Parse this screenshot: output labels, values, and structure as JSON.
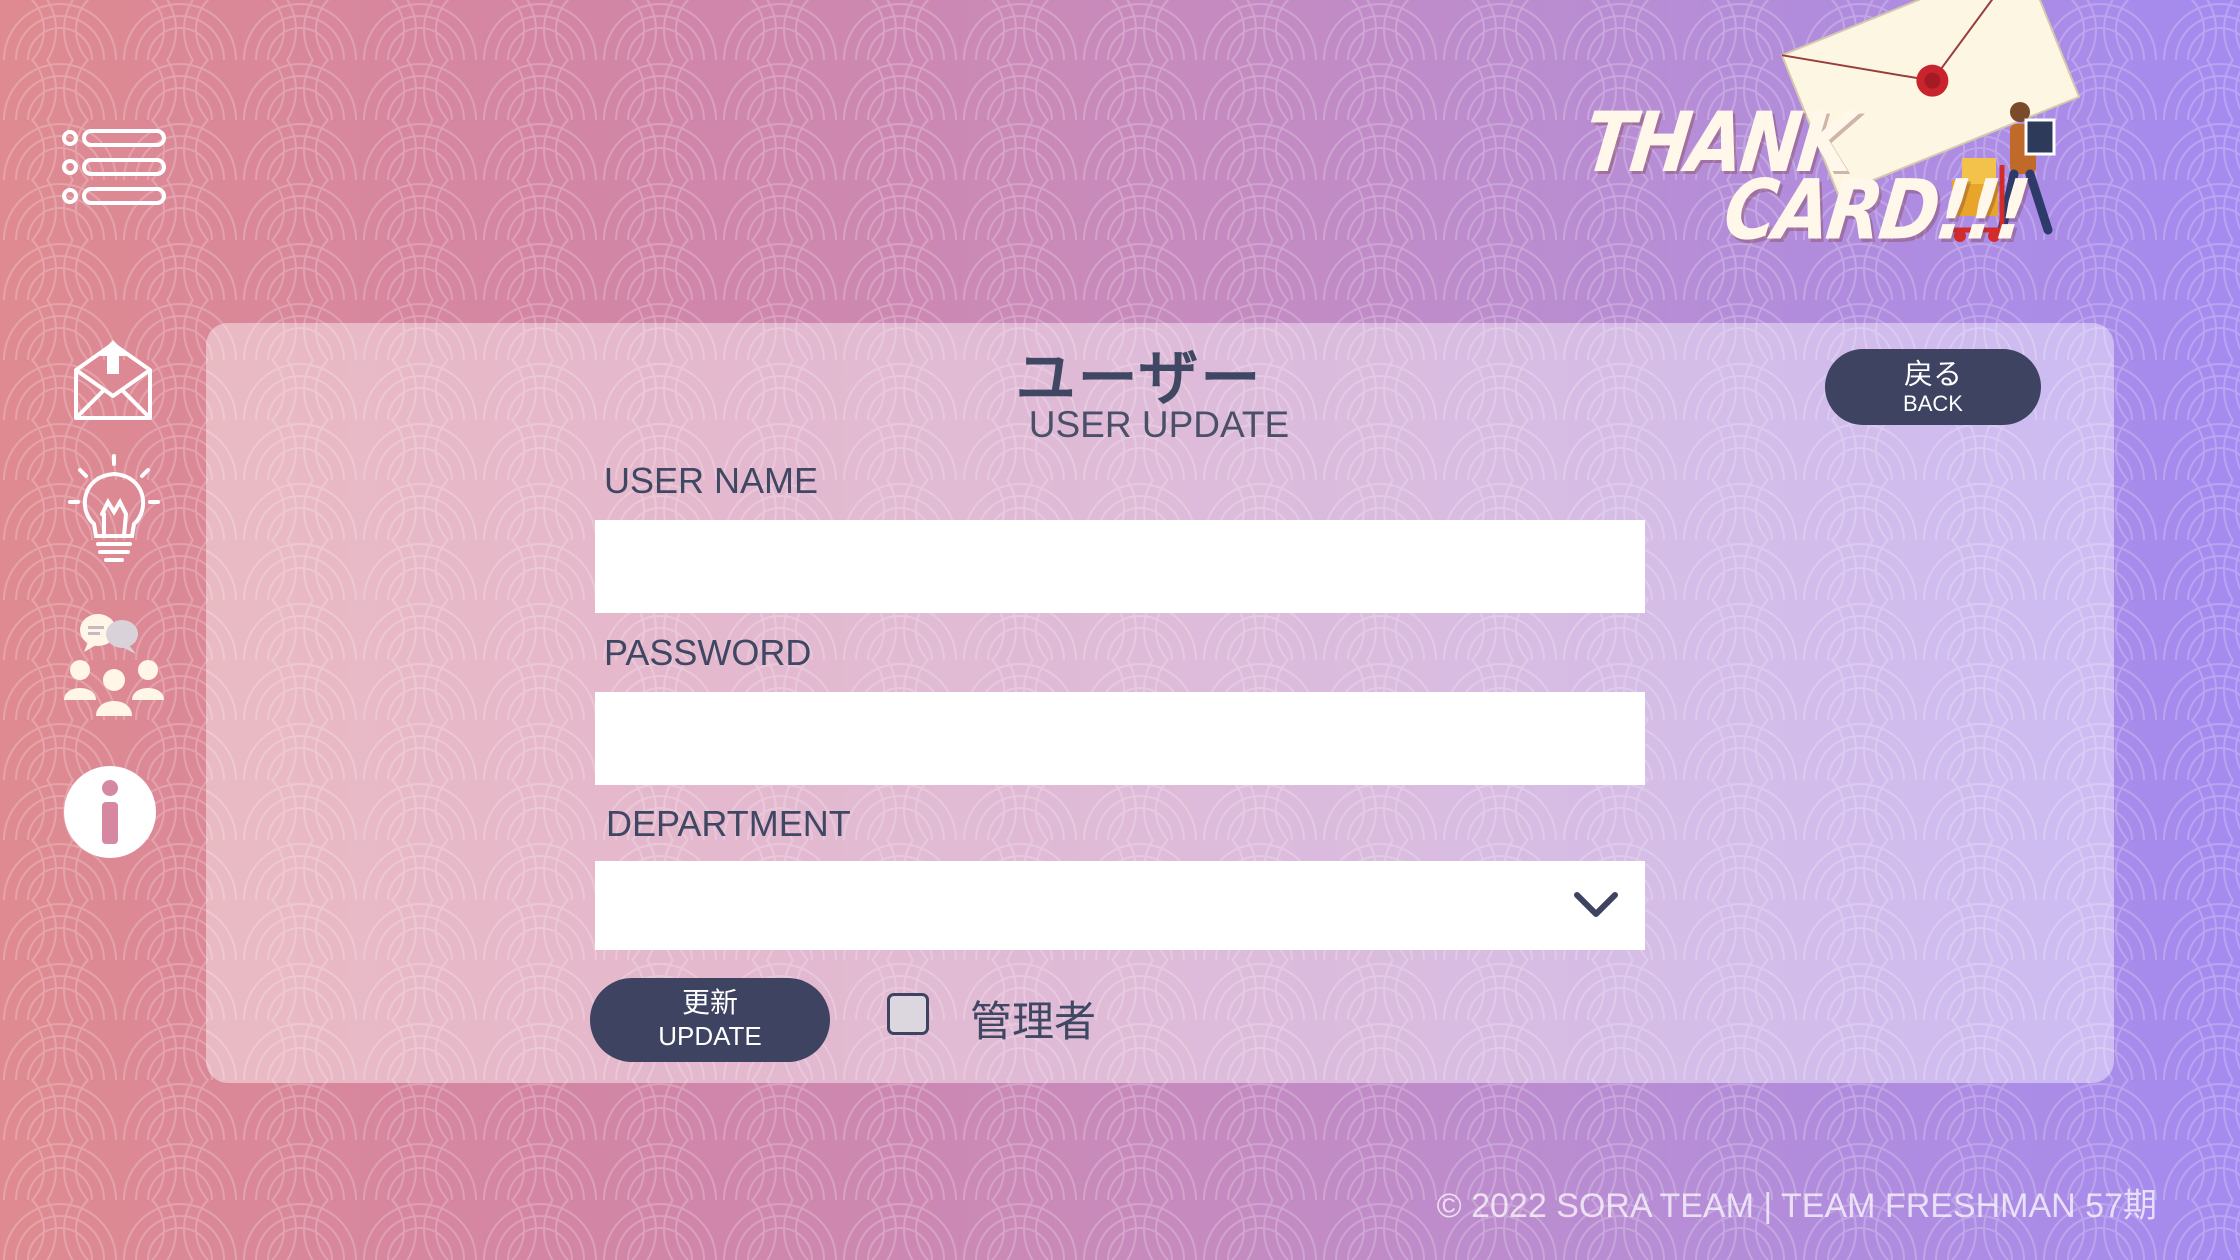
{
  "logo": {
    "line1": "THANK",
    "line2": "CARD!!!"
  },
  "header": {
    "title_jp": "ユーザー",
    "title_en": "USER UPDATE"
  },
  "back_button": {
    "label_jp": "戻る",
    "label_en": "BACK"
  },
  "form": {
    "username": {
      "label": "USER NAME",
      "value": "",
      "placeholder": ""
    },
    "password": {
      "label": "PASSWORD",
      "value": "",
      "placeholder": ""
    },
    "department": {
      "label": "DEPARTMENT",
      "selected": ""
    },
    "update_button": {
      "label_jp": "更新",
      "label_en": "UPDATE"
    },
    "admin_checkbox": {
      "label": "管理者",
      "checked": false
    }
  },
  "sidebar": {
    "items": [
      {
        "icon": "menu-list-icon"
      },
      {
        "icon": "send-mail-icon"
      },
      {
        "icon": "lightbulb-icon"
      },
      {
        "icon": "team-chat-icon"
      },
      {
        "icon": "info-icon"
      }
    ]
  },
  "footer": {
    "copyright": "© 2022 SORA TEAM | TEAM FRESHMAN 57期"
  },
  "colors": {
    "accent": "#3d4360",
    "text": "#3f4763",
    "bg_start": "#df8a90",
    "bg_end": "#a48bf0"
  }
}
